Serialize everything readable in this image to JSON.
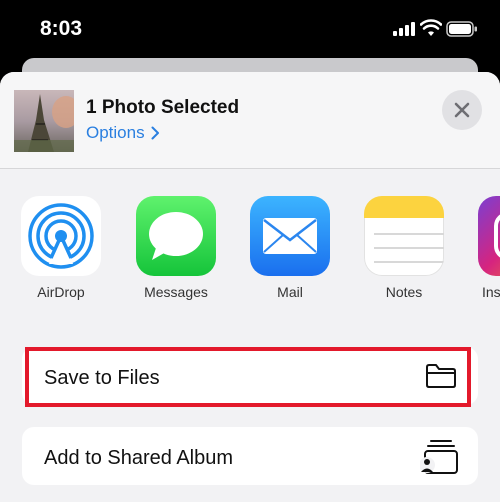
{
  "status": {
    "time": "8:03"
  },
  "share_sheet": {
    "title": "1 Photo Selected",
    "options_label": "Options"
  },
  "apps": [
    {
      "label": "AirDrop",
      "icon": "airdrop-icon"
    },
    {
      "label": "Messages",
      "icon": "messages-icon"
    },
    {
      "label": "Mail",
      "icon": "mail-icon"
    },
    {
      "label": "Notes",
      "icon": "notes-icon"
    },
    {
      "label": "Ins",
      "icon": "instagram-icon"
    }
  ],
  "actions": [
    {
      "label": "Save to Files",
      "icon": "folder-icon"
    },
    {
      "label": "Add to Shared Album",
      "icon": "shared-album-icon"
    }
  ],
  "colors": {
    "highlight": "#e3192b",
    "link": "#2a7fe0"
  }
}
